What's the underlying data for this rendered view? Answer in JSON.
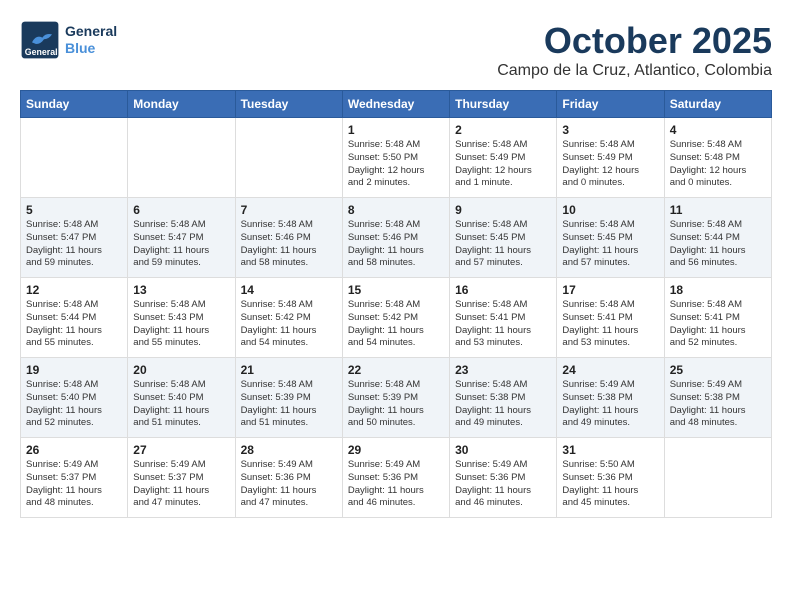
{
  "header": {
    "logo_general": "General",
    "logo_blue": "Blue",
    "month": "October 2025",
    "location": "Campo de la Cruz, Atlantico, Colombia"
  },
  "days_of_week": [
    "Sunday",
    "Monday",
    "Tuesday",
    "Wednesday",
    "Thursday",
    "Friday",
    "Saturday"
  ],
  "weeks": [
    [
      {
        "day": "",
        "info": ""
      },
      {
        "day": "",
        "info": ""
      },
      {
        "day": "",
        "info": ""
      },
      {
        "day": "1",
        "info": "Sunrise: 5:48 AM\nSunset: 5:50 PM\nDaylight: 12 hours\nand 2 minutes."
      },
      {
        "day": "2",
        "info": "Sunrise: 5:48 AM\nSunset: 5:49 PM\nDaylight: 12 hours\nand 1 minute."
      },
      {
        "day": "3",
        "info": "Sunrise: 5:48 AM\nSunset: 5:49 PM\nDaylight: 12 hours\nand 0 minutes."
      },
      {
        "day": "4",
        "info": "Sunrise: 5:48 AM\nSunset: 5:48 PM\nDaylight: 12 hours\nand 0 minutes."
      }
    ],
    [
      {
        "day": "5",
        "info": "Sunrise: 5:48 AM\nSunset: 5:47 PM\nDaylight: 11 hours\nand 59 minutes."
      },
      {
        "day": "6",
        "info": "Sunrise: 5:48 AM\nSunset: 5:47 PM\nDaylight: 11 hours\nand 59 minutes."
      },
      {
        "day": "7",
        "info": "Sunrise: 5:48 AM\nSunset: 5:46 PM\nDaylight: 11 hours\nand 58 minutes."
      },
      {
        "day": "8",
        "info": "Sunrise: 5:48 AM\nSunset: 5:46 PM\nDaylight: 11 hours\nand 58 minutes."
      },
      {
        "day": "9",
        "info": "Sunrise: 5:48 AM\nSunset: 5:45 PM\nDaylight: 11 hours\nand 57 minutes."
      },
      {
        "day": "10",
        "info": "Sunrise: 5:48 AM\nSunset: 5:45 PM\nDaylight: 11 hours\nand 57 minutes."
      },
      {
        "day": "11",
        "info": "Sunrise: 5:48 AM\nSunset: 5:44 PM\nDaylight: 11 hours\nand 56 minutes."
      }
    ],
    [
      {
        "day": "12",
        "info": "Sunrise: 5:48 AM\nSunset: 5:44 PM\nDaylight: 11 hours\nand 55 minutes."
      },
      {
        "day": "13",
        "info": "Sunrise: 5:48 AM\nSunset: 5:43 PM\nDaylight: 11 hours\nand 55 minutes."
      },
      {
        "day": "14",
        "info": "Sunrise: 5:48 AM\nSunset: 5:42 PM\nDaylight: 11 hours\nand 54 minutes."
      },
      {
        "day": "15",
        "info": "Sunrise: 5:48 AM\nSunset: 5:42 PM\nDaylight: 11 hours\nand 54 minutes."
      },
      {
        "day": "16",
        "info": "Sunrise: 5:48 AM\nSunset: 5:41 PM\nDaylight: 11 hours\nand 53 minutes."
      },
      {
        "day": "17",
        "info": "Sunrise: 5:48 AM\nSunset: 5:41 PM\nDaylight: 11 hours\nand 53 minutes."
      },
      {
        "day": "18",
        "info": "Sunrise: 5:48 AM\nSunset: 5:41 PM\nDaylight: 11 hours\nand 52 minutes."
      }
    ],
    [
      {
        "day": "19",
        "info": "Sunrise: 5:48 AM\nSunset: 5:40 PM\nDaylight: 11 hours\nand 52 minutes."
      },
      {
        "day": "20",
        "info": "Sunrise: 5:48 AM\nSunset: 5:40 PM\nDaylight: 11 hours\nand 51 minutes."
      },
      {
        "day": "21",
        "info": "Sunrise: 5:48 AM\nSunset: 5:39 PM\nDaylight: 11 hours\nand 51 minutes."
      },
      {
        "day": "22",
        "info": "Sunrise: 5:48 AM\nSunset: 5:39 PM\nDaylight: 11 hours\nand 50 minutes."
      },
      {
        "day": "23",
        "info": "Sunrise: 5:48 AM\nSunset: 5:38 PM\nDaylight: 11 hours\nand 49 minutes."
      },
      {
        "day": "24",
        "info": "Sunrise: 5:49 AM\nSunset: 5:38 PM\nDaylight: 11 hours\nand 49 minutes."
      },
      {
        "day": "25",
        "info": "Sunrise: 5:49 AM\nSunset: 5:38 PM\nDaylight: 11 hours\nand 48 minutes."
      }
    ],
    [
      {
        "day": "26",
        "info": "Sunrise: 5:49 AM\nSunset: 5:37 PM\nDaylight: 11 hours\nand 48 minutes."
      },
      {
        "day": "27",
        "info": "Sunrise: 5:49 AM\nSunset: 5:37 PM\nDaylight: 11 hours\nand 47 minutes."
      },
      {
        "day": "28",
        "info": "Sunrise: 5:49 AM\nSunset: 5:36 PM\nDaylight: 11 hours\nand 47 minutes."
      },
      {
        "day": "29",
        "info": "Sunrise: 5:49 AM\nSunset: 5:36 PM\nDaylight: 11 hours\nand 46 minutes."
      },
      {
        "day": "30",
        "info": "Sunrise: 5:49 AM\nSunset: 5:36 PM\nDaylight: 11 hours\nand 46 minutes."
      },
      {
        "day": "31",
        "info": "Sunrise: 5:50 AM\nSunset: 5:36 PM\nDaylight: 11 hours\nand 45 minutes."
      },
      {
        "day": "",
        "info": ""
      }
    ]
  ]
}
